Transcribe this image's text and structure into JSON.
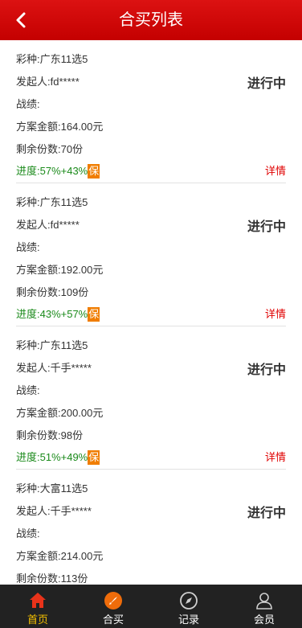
{
  "header": {
    "title": "合买列表"
  },
  "orders": [
    {
      "lottery": "彩种:广东11选5",
      "initiator": "发起人:fd*****",
      "record": "战绩:",
      "amount": "方案金额:164.00元",
      "remaining": "剩余份数:70份",
      "progress": "进度:57%+43%",
      "guarantee": "保",
      "status": "进行中",
      "detail": "详情"
    },
    {
      "lottery": "彩种:广东11选5",
      "initiator": "发起人:fd*****",
      "record": "战绩:",
      "amount": "方案金额:192.00元",
      "remaining": "剩余份数:109份",
      "progress": "进度:43%+57%",
      "guarantee": "保",
      "status": "进行中",
      "detail": "详情"
    },
    {
      "lottery": "彩种:广东11选5",
      "initiator": "发起人:千手*****",
      "record": "战绩:",
      "amount": "方案金额:200.00元",
      "remaining": "剩余份数:98份",
      "progress": "进度:51%+49%",
      "guarantee": "保",
      "status": "进行中",
      "detail": "详情"
    },
    {
      "lottery": "彩种:大富11选5",
      "initiator": "发起人:千手*****",
      "record": "战绩:",
      "amount": "方案金额:214.00元",
      "remaining": "剩余份数:113份",
      "progress": "",
      "guarantee": "",
      "status": "进行中",
      "detail": ""
    }
  ],
  "tabbar": {
    "items": [
      {
        "label": "首页",
        "icon": "home-icon"
      },
      {
        "label": "合买",
        "icon": "joint-buy-icon"
      },
      {
        "label": "记录",
        "icon": "compass-icon"
      },
      {
        "label": "会员",
        "icon": "user-icon"
      }
    ],
    "active": "首页"
  },
  "colors": {
    "header_red": "#d00a0a",
    "active_tab": "#f5c000",
    "progress_green": "#1a8a1a",
    "guarantee_orange": "#f07d00",
    "detail_red": "#e00000",
    "tabbar_bg": "#222222"
  }
}
